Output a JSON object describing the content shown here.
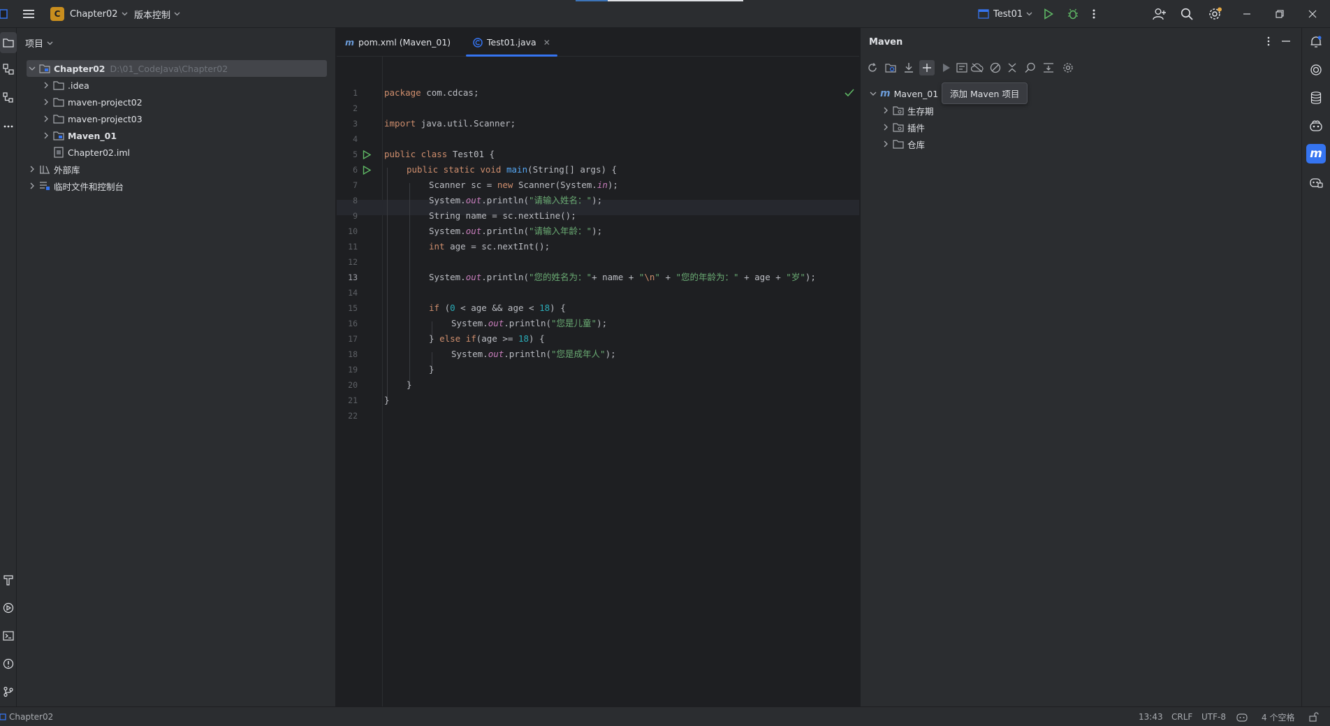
{
  "titlebar": {
    "project_initial": "C",
    "project_name": "Chapter02",
    "vcs_label": "版本控制",
    "run_config": "Test01"
  },
  "project_panel": {
    "title": "项目",
    "root": {
      "name": "Chapter02",
      "path": "D:\\01_CodeJava\\Chapter02"
    },
    "items": [
      {
        "label": ".idea"
      },
      {
        "label": "maven-project02"
      },
      {
        "label": "maven-project03"
      },
      {
        "label": "Maven_01"
      },
      {
        "label": "Chapter02.iml"
      }
    ],
    "external_libs": "外部库",
    "scratches": "临时文件和控制台"
  },
  "editor": {
    "tabs": [
      {
        "label": "pom.xml (Maven_01)"
      },
      {
        "label": "Test01.java"
      }
    ],
    "code": {
      "l1a": "package",
      "l1b": " com.cdcas;",
      "l3a": "import",
      "l3b": " java.util.Scanner;",
      "l5a": "public class",
      "l5b": " Test01 {",
      "l6a": "public static void",
      "l6b": "main",
      "l6c": "(String[] args) {",
      "l7a": "Scanner sc = ",
      "l7b": "new",
      "l7c": " Scanner(System.",
      "l7d": "in",
      "l7e": ");",
      "l8a": "System.",
      "l8b": "out",
      "l8c": ".println(",
      "l8d": "\"请输入姓名：\"",
      "l8e": ");",
      "l9": "String name = sc.nextLine();",
      "l10a": "System.",
      "l10b": "out",
      "l10c": ".println(",
      "l10d": "\"请输入年龄：\"",
      "l10e": ");",
      "l11a": "int",
      "l11b": " age = sc.nextInt();",
      "l13a": "System.",
      "l13b": "out",
      "l13c": ".println(",
      "l13d": "\"您的姓名为：\"",
      "l13e": "+ name + ",
      "l13f": "\"",
      "l13g": "\\n",
      "l13h": "\"",
      "l13i": " + ",
      "l13j": "\"您的年龄为：\"",
      "l13k": " + age + ",
      "l13l": "\"岁\"",
      "l13m": ");",
      "l15a": "if",
      "l15b": " (",
      "l15c": "0",
      "l15d": " < age && age < ",
      "l15e": "18",
      "l15f": ") {",
      "l16a": "System.",
      "l16b": "out",
      "l16c": ".println(",
      "l16d": "\"您是儿童\"",
      "l16e": ");",
      "l17a": "} ",
      "l17b": "else if",
      "l17c": "(age >= ",
      "l17d": "18",
      "l17e": ") {",
      "l18a": "System.",
      "l18b": "out",
      "l18c": ".println(",
      "l18d": "\"您是成年人\"",
      "l18e": ");",
      "l19": "}",
      "l20": "}",
      "l21": "}"
    },
    "line_numbers": [
      "1",
      "2",
      "3",
      "4",
      "5",
      "6",
      "7",
      "8",
      "9",
      "10",
      "11",
      "12",
      "13",
      "14",
      "15",
      "16",
      "17",
      "18",
      "19",
      "20",
      "21",
      "22"
    ]
  },
  "maven_panel": {
    "title": "Maven",
    "tooltip": "添加 Maven 项目",
    "tree": {
      "root": "Maven_01",
      "children": [
        "生存期",
        "插件",
        "仓库"
      ]
    }
  },
  "statusbar": {
    "project": "Chapter02",
    "position": "13:43",
    "line_sep": "CRLF",
    "encoding": "UTF-8",
    "indent": "4 个空格"
  },
  "colors": {
    "accent": "#3574f0",
    "keyword": "#cf8e6d",
    "string": "#6aab73",
    "function": "#56a8f5",
    "number": "#2aacb8",
    "field": "#c77dbb",
    "run_green": "#5fb865"
  }
}
